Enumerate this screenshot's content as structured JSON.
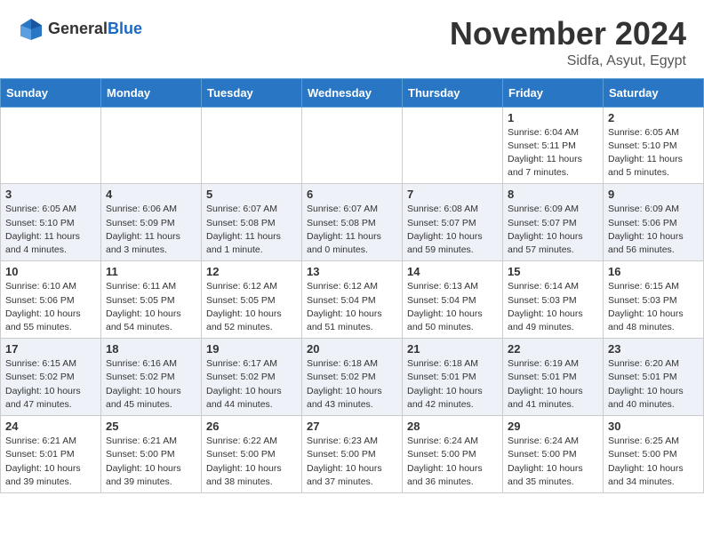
{
  "header": {
    "logo_general": "General",
    "logo_blue": "Blue",
    "month_title": "November 2024",
    "location": "Sidfa, Asyut, Egypt"
  },
  "weekdays": [
    "Sunday",
    "Monday",
    "Tuesday",
    "Wednesday",
    "Thursday",
    "Friday",
    "Saturday"
  ],
  "weeks": [
    [
      {
        "day": "",
        "info": ""
      },
      {
        "day": "",
        "info": ""
      },
      {
        "day": "",
        "info": ""
      },
      {
        "day": "",
        "info": ""
      },
      {
        "day": "",
        "info": ""
      },
      {
        "day": "1",
        "info": "Sunrise: 6:04 AM\nSunset: 5:11 PM\nDaylight: 11 hours and 7 minutes."
      },
      {
        "day": "2",
        "info": "Sunrise: 6:05 AM\nSunset: 5:10 PM\nDaylight: 11 hours and 5 minutes."
      }
    ],
    [
      {
        "day": "3",
        "info": "Sunrise: 6:05 AM\nSunset: 5:10 PM\nDaylight: 11 hours and 4 minutes."
      },
      {
        "day": "4",
        "info": "Sunrise: 6:06 AM\nSunset: 5:09 PM\nDaylight: 11 hours and 3 minutes."
      },
      {
        "day": "5",
        "info": "Sunrise: 6:07 AM\nSunset: 5:08 PM\nDaylight: 11 hours and 1 minute."
      },
      {
        "day": "6",
        "info": "Sunrise: 6:07 AM\nSunset: 5:08 PM\nDaylight: 11 hours and 0 minutes."
      },
      {
        "day": "7",
        "info": "Sunrise: 6:08 AM\nSunset: 5:07 PM\nDaylight: 10 hours and 59 minutes."
      },
      {
        "day": "8",
        "info": "Sunrise: 6:09 AM\nSunset: 5:07 PM\nDaylight: 10 hours and 57 minutes."
      },
      {
        "day": "9",
        "info": "Sunrise: 6:09 AM\nSunset: 5:06 PM\nDaylight: 10 hours and 56 minutes."
      }
    ],
    [
      {
        "day": "10",
        "info": "Sunrise: 6:10 AM\nSunset: 5:06 PM\nDaylight: 10 hours and 55 minutes."
      },
      {
        "day": "11",
        "info": "Sunrise: 6:11 AM\nSunset: 5:05 PM\nDaylight: 10 hours and 54 minutes."
      },
      {
        "day": "12",
        "info": "Sunrise: 6:12 AM\nSunset: 5:05 PM\nDaylight: 10 hours and 52 minutes."
      },
      {
        "day": "13",
        "info": "Sunrise: 6:12 AM\nSunset: 5:04 PM\nDaylight: 10 hours and 51 minutes."
      },
      {
        "day": "14",
        "info": "Sunrise: 6:13 AM\nSunset: 5:04 PM\nDaylight: 10 hours and 50 minutes."
      },
      {
        "day": "15",
        "info": "Sunrise: 6:14 AM\nSunset: 5:03 PM\nDaylight: 10 hours and 49 minutes."
      },
      {
        "day": "16",
        "info": "Sunrise: 6:15 AM\nSunset: 5:03 PM\nDaylight: 10 hours and 48 minutes."
      }
    ],
    [
      {
        "day": "17",
        "info": "Sunrise: 6:15 AM\nSunset: 5:02 PM\nDaylight: 10 hours and 47 minutes."
      },
      {
        "day": "18",
        "info": "Sunrise: 6:16 AM\nSunset: 5:02 PM\nDaylight: 10 hours and 45 minutes."
      },
      {
        "day": "19",
        "info": "Sunrise: 6:17 AM\nSunset: 5:02 PM\nDaylight: 10 hours and 44 minutes."
      },
      {
        "day": "20",
        "info": "Sunrise: 6:18 AM\nSunset: 5:02 PM\nDaylight: 10 hours and 43 minutes."
      },
      {
        "day": "21",
        "info": "Sunrise: 6:18 AM\nSunset: 5:01 PM\nDaylight: 10 hours and 42 minutes."
      },
      {
        "day": "22",
        "info": "Sunrise: 6:19 AM\nSunset: 5:01 PM\nDaylight: 10 hours and 41 minutes."
      },
      {
        "day": "23",
        "info": "Sunrise: 6:20 AM\nSunset: 5:01 PM\nDaylight: 10 hours and 40 minutes."
      }
    ],
    [
      {
        "day": "24",
        "info": "Sunrise: 6:21 AM\nSunset: 5:01 PM\nDaylight: 10 hours and 39 minutes."
      },
      {
        "day": "25",
        "info": "Sunrise: 6:21 AM\nSunset: 5:00 PM\nDaylight: 10 hours and 39 minutes."
      },
      {
        "day": "26",
        "info": "Sunrise: 6:22 AM\nSunset: 5:00 PM\nDaylight: 10 hours and 38 minutes."
      },
      {
        "day": "27",
        "info": "Sunrise: 6:23 AM\nSunset: 5:00 PM\nDaylight: 10 hours and 37 minutes."
      },
      {
        "day": "28",
        "info": "Sunrise: 6:24 AM\nSunset: 5:00 PM\nDaylight: 10 hours and 36 minutes."
      },
      {
        "day": "29",
        "info": "Sunrise: 6:24 AM\nSunset: 5:00 PM\nDaylight: 10 hours and 35 minutes."
      },
      {
        "day": "30",
        "info": "Sunrise: 6:25 AM\nSunset: 5:00 PM\nDaylight: 10 hours and 34 minutes."
      }
    ]
  ]
}
